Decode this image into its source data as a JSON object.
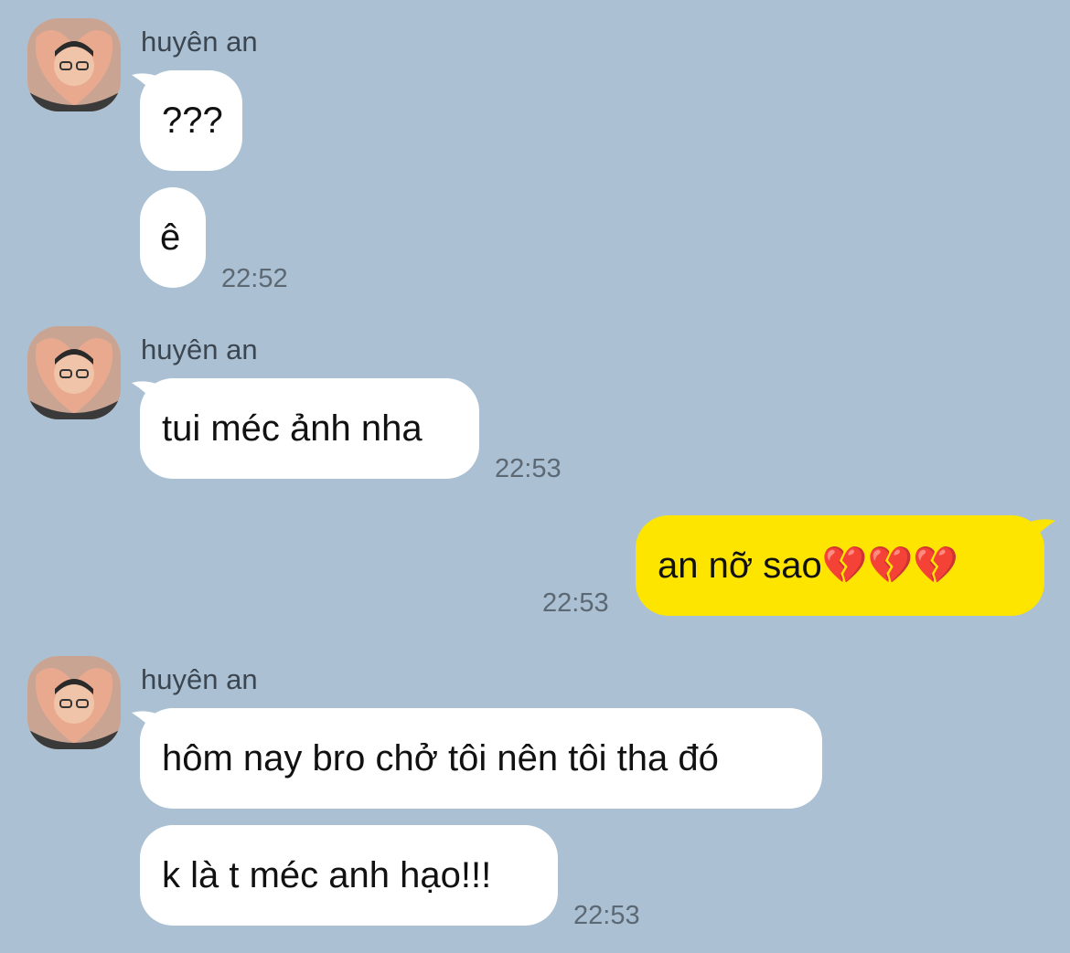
{
  "groups": [
    {
      "sender": "huyên an",
      "avatar_icon": "profile-photo-heart-hands",
      "messages": [
        {
          "text": "???"
        },
        {
          "text": "ê",
          "time": "22:52"
        }
      ]
    },
    {
      "sender": "huyên an",
      "avatar_icon": "profile-photo-heart-hands",
      "messages": [
        {
          "text": "tui méc ảnh nha",
          "time": "22:53"
        }
      ]
    },
    {
      "outgoing": true,
      "messages": [
        {
          "text": "an nỡ sao💔💔💔",
          "time": "22:53"
        }
      ]
    },
    {
      "sender": "huyên an",
      "avatar_icon": "profile-photo-heart-hands",
      "messages": [
        {
          "text": "hôm nay bro chở tôi nên tôi tha đó"
        },
        {
          "text": "k là t méc anh hạo!!!",
          "time": "22:53"
        }
      ]
    }
  ],
  "colors": {
    "background": "#abc1d3",
    "incoming_bubble": "#ffffff",
    "outgoing_bubble": "#fee500"
  }
}
